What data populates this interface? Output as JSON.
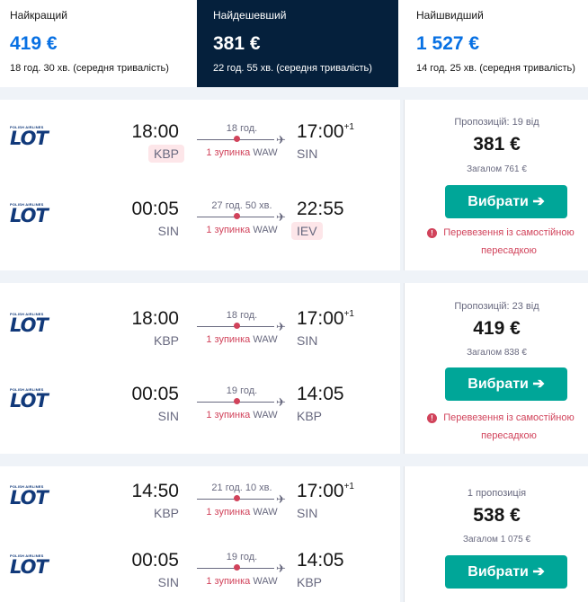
{
  "tabs": [
    {
      "title": "Найкращий",
      "price": "419 €",
      "sub": "18 год. 30 хв. (середня тривалість)"
    },
    {
      "title": "Найдешевший",
      "price": "381 €",
      "sub": "22 год. 55 хв. (середня тривалість)"
    },
    {
      "title": "Найшвидший",
      "price": "1 527 €",
      "sub": "14 год. 25 хв. (середня тривалість)"
    }
  ],
  "airline": {
    "tiny": "POLISH AIRLINES",
    "name": "LOT"
  },
  "select_label": "Вибрати ➔",
  "cards": [
    {
      "legs": [
        {
          "dep_time": "18:00",
          "dep_airport": "KBP",
          "arr_time": "17:00",
          "arr_plus": "+1",
          "arr_airport": "SIN",
          "duration": "18 год.",
          "stops": "1 зупинка",
          "via": "WAW"
        },
        {
          "dep_time": "00:05",
          "dep_airport": "SIN",
          "arr_time": "22:55",
          "arr_plus": "",
          "arr_airport": "IEV",
          "duration": "27 год. 50 хв.",
          "stops": "1 зупинка",
          "via": "WAW"
        }
      ],
      "offers": "Пропозицій: 19 від",
      "price": "381 €",
      "total": "Загалом 761 €",
      "warning": "Перевезення із самостійною пересадкою"
    },
    {
      "legs": [
        {
          "dep_time": "18:00",
          "dep_airport": "KBP",
          "arr_time": "17:00",
          "arr_plus": "+1",
          "arr_airport": "SIN",
          "duration": "18 год.",
          "stops": "1 зупинка",
          "via": "WAW"
        },
        {
          "dep_time": "00:05",
          "dep_airport": "SIN",
          "arr_time": "14:05",
          "arr_plus": "",
          "arr_airport": "KBP",
          "duration": "19 год.",
          "stops": "1 зупинка",
          "via": "WAW"
        }
      ],
      "offers": "Пропозицій: 23 від",
      "price": "419 €",
      "total": "Загалом 838 €",
      "warning": "Перевезення із самостійною пересадкою"
    },
    {
      "legs": [
        {
          "dep_time": "14:50",
          "dep_airport": "KBP",
          "arr_time": "17:00",
          "arr_plus": "+1",
          "arr_airport": "SIN",
          "duration": "21 год. 10 хв.",
          "stops": "1 зупинка",
          "via": "WAW"
        },
        {
          "dep_time": "00:05",
          "dep_airport": "SIN",
          "arr_time": "14:05",
          "arr_plus": "",
          "arr_airport": "KBP",
          "duration": "19 год.",
          "stops": "1 зупинка",
          "via": "WAW"
        }
      ],
      "offers": "1 пропозиція",
      "price": "538 €",
      "total": "Загалом 1 075 €",
      "warning": ""
    }
  ],
  "colors": {
    "accent": "#0770e3",
    "dark_tab": "#05203c",
    "button": "#00a698",
    "warning": "#d1435b"
  }
}
